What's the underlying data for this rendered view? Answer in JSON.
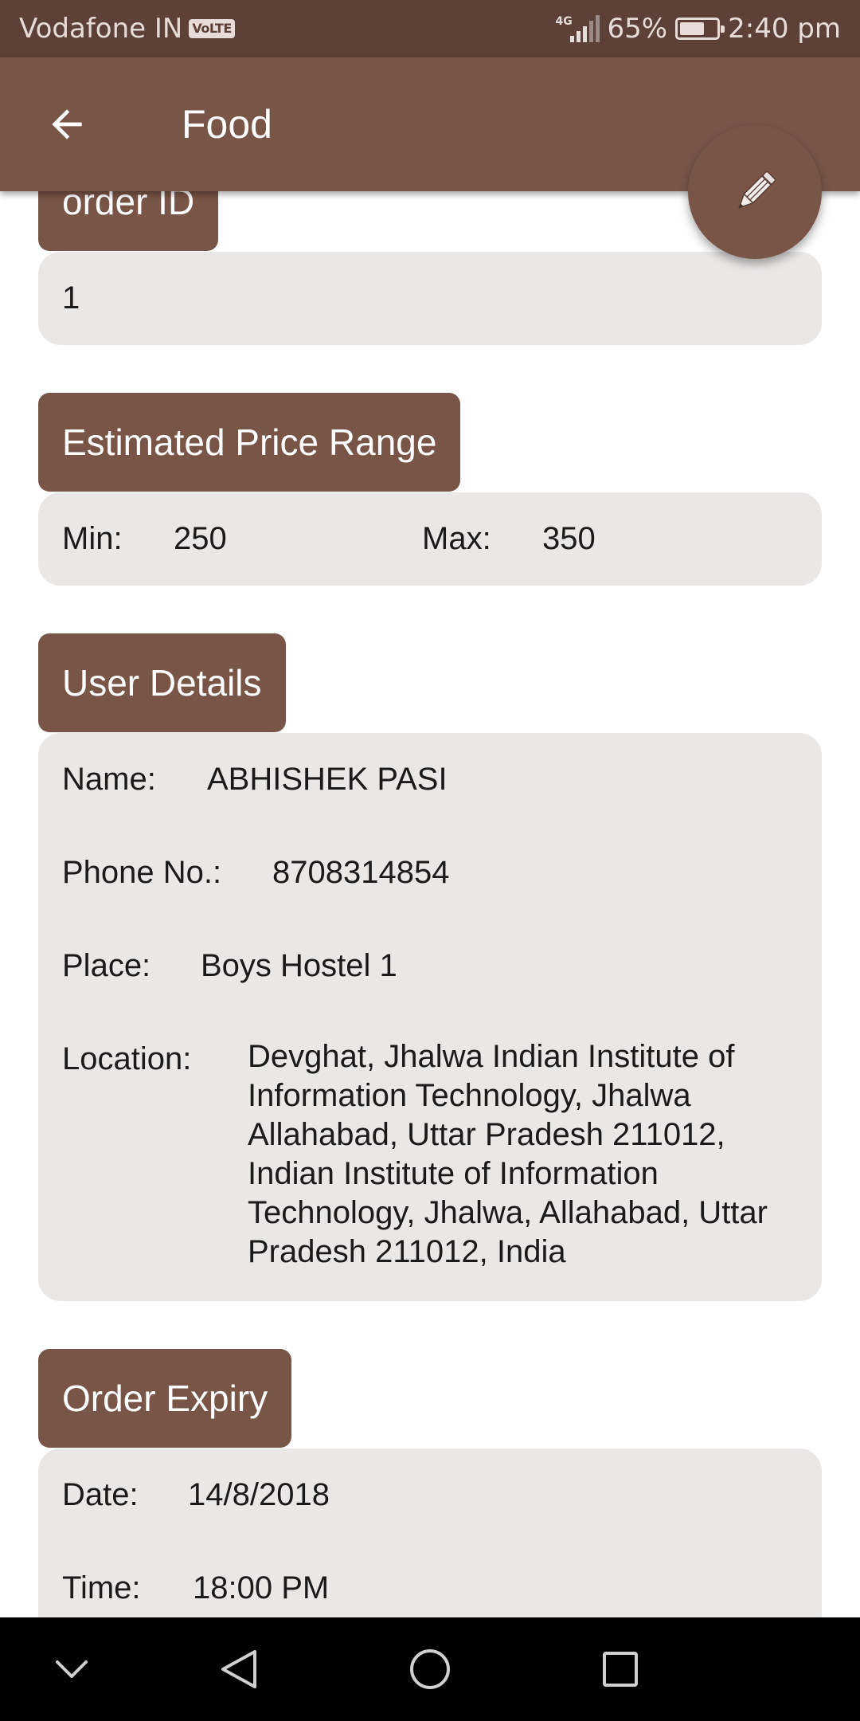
{
  "status_bar": {
    "carrier": "Vodafone IN",
    "volte_badge": "VoLTE",
    "network_type": "4G",
    "battery": "65%",
    "time": "2:40 pm"
  },
  "app_bar": {
    "title": "Food",
    "back_icon": "arrow-back-icon",
    "fab_icon": "pencil-icon"
  },
  "order": {
    "id_label": "order ID",
    "id_value": "1"
  },
  "price_range": {
    "label": "Estimated Price Range",
    "min_label": "Min:",
    "min_value": "250",
    "max_label": "Max:",
    "max_value": "350"
  },
  "user_details": {
    "label": "User Details",
    "name_label": "Name:",
    "name_value": "ABHISHEK PASI",
    "phone_label": "Phone No.:",
    "phone_value": "8708314854",
    "place_label": "Place:",
    "place_value": "Boys Hostel 1",
    "location_label": "Location:",
    "location_value": "Devghat, Jhalwa Indian Institute of Information Technology, Jhalwa Allahabad, Uttar Pradesh 211012, Indian Institute of Information Technology, Jhalwa, Allahabad, Uttar Pradesh 211012, India"
  },
  "order_expiry": {
    "label": "Order Expiry",
    "date_label": "Date:",
    "date_value": "14/8/2018",
    "time_label": "Time:",
    "time_value": "18:00 PM"
  },
  "nav_bar": {
    "icons": [
      "chevron-down-icon",
      "back-triangle-icon",
      "home-circle-icon",
      "recents-square-icon"
    ]
  },
  "colors": {
    "status_bar": "#5d4037",
    "primary": "#795548",
    "card_bg": "#eae8e7"
  }
}
